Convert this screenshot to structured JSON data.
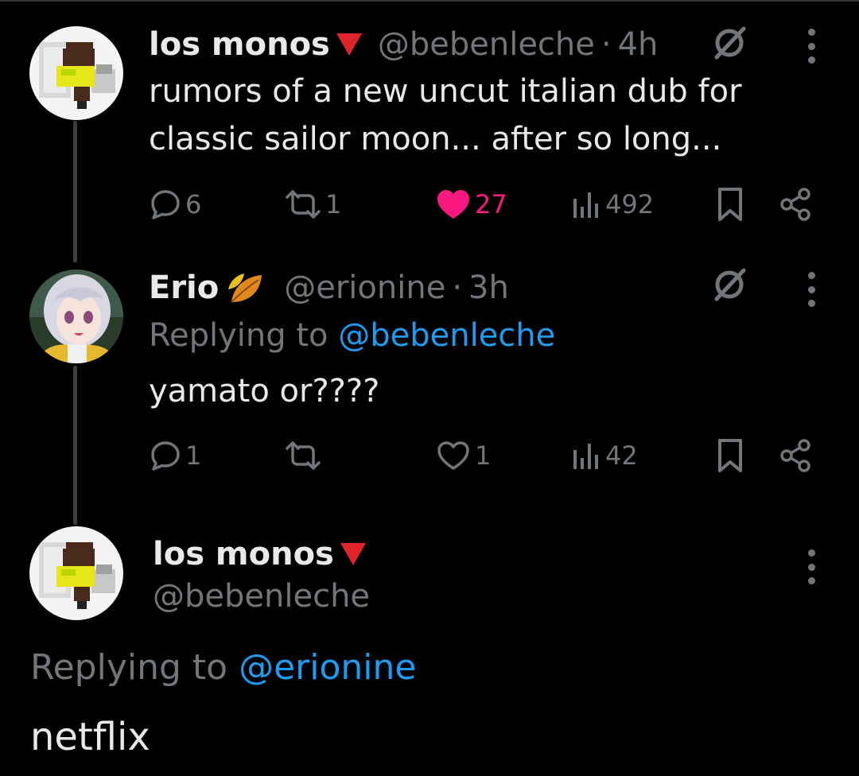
{
  "tweet1": {
    "name": "los monos",
    "handle": "@bebenleche",
    "sep": "·",
    "time": "4h",
    "text_line1": "rumors of a new uncut italian dub for",
    "text_line2": "classic sailor moon... after so long...",
    "replies": "6",
    "retweets": "1",
    "likes": "27",
    "views": "492",
    "liked": true,
    "avatar_icon": "pixel-character-avatar",
    "flag_icon": "red-triangle-down-icon"
  },
  "tweet2": {
    "name": "Erio",
    "handle": "@erionine",
    "sep": "·",
    "time": "3h",
    "replying_prefix": "Replying to",
    "replying_mention": "@bebenleche",
    "text": "yamato or????",
    "replies": "1",
    "retweets": "",
    "likes": "1",
    "views": "42",
    "avatar_icon": "anime-girl-avatar",
    "leaf_icon": "autumn-leaf-icon"
  },
  "tweet3": {
    "name": "los monos",
    "handle": "@bebenleche",
    "replying_prefix": "Replying to",
    "replying_mention": "@erionine",
    "text": "netflix"
  },
  "colors": {
    "background": "#000000",
    "text": "#e7e9ea",
    "secondary": "#71767b",
    "link": "#1d9bf0",
    "like": "#f91880",
    "flag": "#e0242b"
  }
}
